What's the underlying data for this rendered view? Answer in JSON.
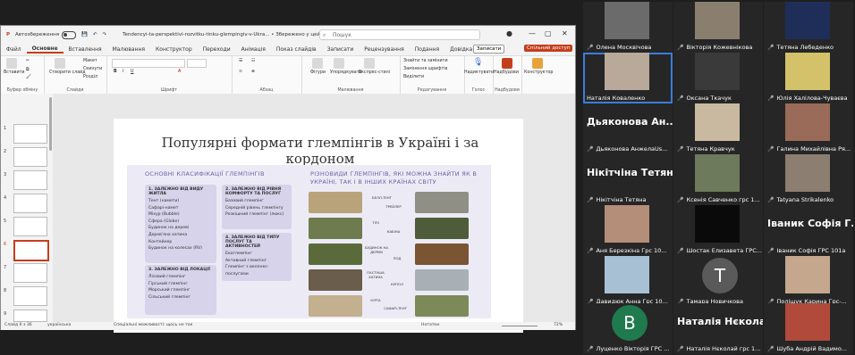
{
  "ppt": {
    "autosave_label": "Автозбереження",
    "doc_title": "Tendencyi-ta-perspektivi-rozvitku-tinku-glempingiv-v-Ukra... • Збережено у цей ПК",
    "search_placeholder": "Пошук",
    "menu": [
      "Файл",
      "Основне",
      "Вставлення",
      "Малювання",
      "Конструктор",
      "Переходи",
      "Анімація",
      "Показ слайдів",
      "Записати",
      "Рецензування",
      "Подання",
      "Довідка"
    ],
    "active_tab": "Основне",
    "comments_label": "Записати",
    "share_label": "Спільний доступ",
    "ribbon": {
      "paste": "Вставити",
      "create_slide": "Створити слайд",
      "layout": "Макет",
      "reset": "Скинути",
      "section": "Розділ",
      "shapes": "Фігури",
      "arrange": "Упорядкувати",
      "quick_styles": "Експрес-стилі",
      "find_replace": "Знайти та замінити",
      "replace_fonts": "Замінення шрифтів",
      "select": "Виділити",
      "dictate": "Надиктувати",
      "addins": "Надбудови",
      "designer": "Конструктор",
      "groups": [
        "Буфер обміну",
        "Слайди",
        "Шрифт",
        "Абзац",
        "Малювання",
        "Редагування",
        "Голос",
        "Надбудови"
      ]
    },
    "thumb_numbers": [
      "1",
      "2",
      "3",
      "4",
      "5",
      "6",
      "7",
      "8",
      "9"
    ],
    "status": {
      "slide_info": "Слайд 6 з 36",
      "language": "українська",
      "accessibility": "Спеціальні можливості: щось не так",
      "notes": "Нотатки",
      "zoom": "72%"
    },
    "slide": {
      "title": "Популярні формати глемпінгів в Україні і за кордоном",
      "left_heading": "ОСНОВНІ КЛАСИФІКАЦІЇ ГЛЕМПІНГІВ",
      "right_heading": "РІЗНОВИДИ ГЛЕМПІНГІВ, ЯКІ МОЖНА ЗНАЙТИ ЯК В УКРАЇНІ, ТАК І В ІНШИХ КРАЇНАХ СВІТУ",
      "cards": [
        {
          "title": "1. ЗАЛЕЖНО ВІД ВИДУ ЖИТЛА",
          "items": [
            "Тент (намети)",
            "Сафарі-намет",
            "Міхур (Bubble)",
            "Сфера (Globe)",
            "Будинок на дереві",
            "Дерев'яна хатина",
            "Контейнер",
            "Будинок на колесах (RV)"
          ]
        },
        {
          "title": "2. ЗАЛЕЖНО ВІД РІВНЯ КОМФОРТУ ТА ПОСЛУГ",
          "items": [
            "Базовий глемпінг",
            "Середній рівень глемпінгу",
            "Розкішний глемпінг (люкс)"
          ]
        },
        {
          "title": "3. ЗАЛЕЖНО ВІД ЛОКАЦІЇ",
          "items": [
            "Лісовий глемпінг",
            "Гірський глемпінг",
            "Морський глемпінг",
            "Сільський глемпінг"
          ]
        },
        {
          "title": "4. ЗАЛЕЖНО ВІД ТИПУ ПОСЛУГ ТА АКТИВНОСТЕЙ",
          "items": [
            "Екоглемпінг",
            "Активний глемпінг",
            "Глемпінг з веллнес-послугами"
          ]
        }
      ],
      "photo_labels": [
        "БЕЛЛ-ТЕНТ",
        "ТРЕЙЛЕР",
        "ТІПІ",
        "КАБІНА",
        "БУДИНОК НА ДЕРЕВІ",
        "ПОД",
        "ПАСТУША ХАТИНА",
        "КУПОЛ",
        "ЮРТА",
        "САФАРІ-ТЕНТ"
      ]
    }
  },
  "participants": [
    {
      "name": "Олена Москвічова",
      "active": false
    },
    {
      "name": "Вікторія Кожевнікова",
      "active": false
    },
    {
      "name": "Тетяна Лебеденко",
      "active": false
    },
    {
      "name": "Наталія Коваленко",
      "active": true
    },
    {
      "name": "Оксана Ткачук",
      "active": false
    },
    {
      "name": "Юлія Халілова-Чуваєва",
      "active": false
    },
    {
      "name": "Дьяконова АнжелаUs...",
      "active": false,
      "big": "Дьяконова Ан..."
    },
    {
      "name": "Тетяна Кравчук",
      "active": false
    },
    {
      "name": "Галина Михайлівна Ря...",
      "active": false
    },
    {
      "name": "Нікітчіна Тетяна",
      "active": false,
      "big": "Нікітчіна Тетяна"
    },
    {
      "name": "Ксенія Савченко грс 1...",
      "active": false
    },
    {
      "name": "Tatyana Strikalenko",
      "active": false
    },
    {
      "name": "Аня Березкіна Грс 10...",
      "active": false
    },
    {
      "name": "Шостак Елизавета ГРС...",
      "active": false
    },
    {
      "name": "Іваник Софія ГРС 101а",
      "active": false,
      "big": "Іваник Софія Г..."
    },
    {
      "name": "Давидюк Анна Грс 10...",
      "active": false
    },
    {
      "name": "Тамара Новичкова",
      "active": false,
      "letter": "Т"
    },
    {
      "name": "Поліщук Карина Грс-...",
      "active": false
    },
    {
      "name": "Луценко Вікторія ГРС ...",
      "active": false,
      "letter": "В"
    },
    {
      "name": "Наталія Нєколай грс 1...",
      "active": false,
      "big": "Наталія Нєкола..."
    },
    {
      "name": "Шуба Андрій Вадимо...",
      "active": false
    }
  ]
}
